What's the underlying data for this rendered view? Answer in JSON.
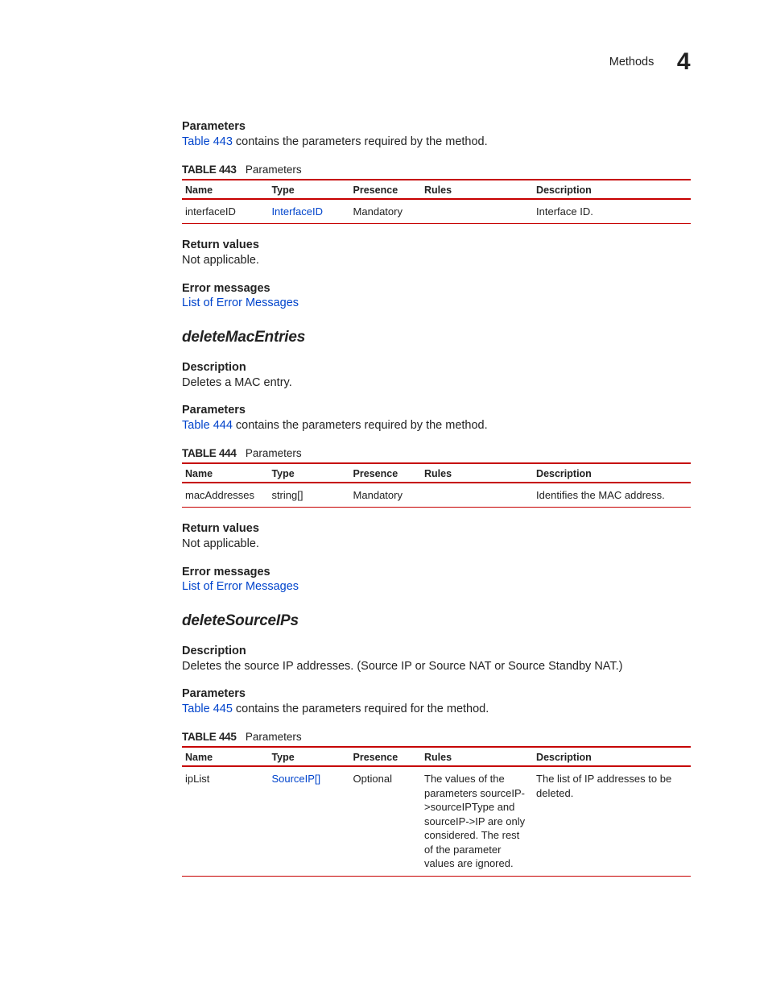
{
  "running_head": {
    "section": "Methods",
    "chapter_number": "4"
  },
  "section1": {
    "parameters_heading": "Parameters",
    "parameters_text_pre": "Table 443",
    "parameters_text_post": " contains the parameters required by the method.",
    "table": {
      "caption_num": "TABLE 443",
      "caption_label": "Parameters",
      "headers": {
        "name": "Name",
        "type": "Type",
        "presence": "Presence",
        "rules": "Rules",
        "description": "Description"
      },
      "rows": [
        {
          "name": "interfaceID",
          "type": "InterfaceID",
          "type_is_link": true,
          "presence": "Mandatory",
          "rules": "",
          "description": "Interface ID."
        }
      ]
    },
    "return_heading": "Return values",
    "return_text": "Not applicable.",
    "error_heading": "Error messages",
    "error_link": "List of Error Messages"
  },
  "method2": {
    "title": "deleteMacEntries",
    "description_heading": "Description",
    "description_text": "Deletes a MAC entry.",
    "parameters_heading": "Parameters",
    "parameters_text_pre": "Table 444",
    "parameters_text_post": " contains the parameters required by the method.",
    "table": {
      "caption_num": "TABLE 444",
      "caption_label": "Parameters",
      "headers": {
        "name": "Name",
        "type": "Type",
        "presence": "Presence",
        "rules": "Rules",
        "description": "Description"
      },
      "rows": [
        {
          "name": "macAddresses",
          "type": "string[]",
          "type_is_link": false,
          "presence": "Mandatory",
          "rules": "",
          "description": "Identifies the MAC address."
        }
      ]
    },
    "return_heading": "Return values",
    "return_text": "Not applicable.",
    "error_heading": "Error messages",
    "error_link": "List of Error Messages"
  },
  "method3": {
    "title": "deleteSourceIPs",
    "description_heading": "Description",
    "description_text": "Deletes the source IP addresses. (Source IP or Source NAT or Source Standby NAT.)",
    "parameters_heading": "Parameters",
    "parameters_text_pre": "Table 445",
    "parameters_text_post": " contains the parameters required for the method.",
    "table": {
      "caption_num": "TABLE 445",
      "caption_label": "Parameters",
      "headers": {
        "name": "Name",
        "type": "Type",
        "presence": "Presence",
        "rules": "Rules",
        "description": "Description"
      },
      "rows": [
        {
          "name": "ipList",
          "type": "SourceIP[]",
          "type_is_link": true,
          "presence": "Optional",
          "rules": "The values of the parameters sourceIP->sourceIPType and sourceIP->IP are only considered. The rest of the parameter values are ignored.",
          "description": "The list of IP addresses to be deleted."
        }
      ]
    }
  }
}
